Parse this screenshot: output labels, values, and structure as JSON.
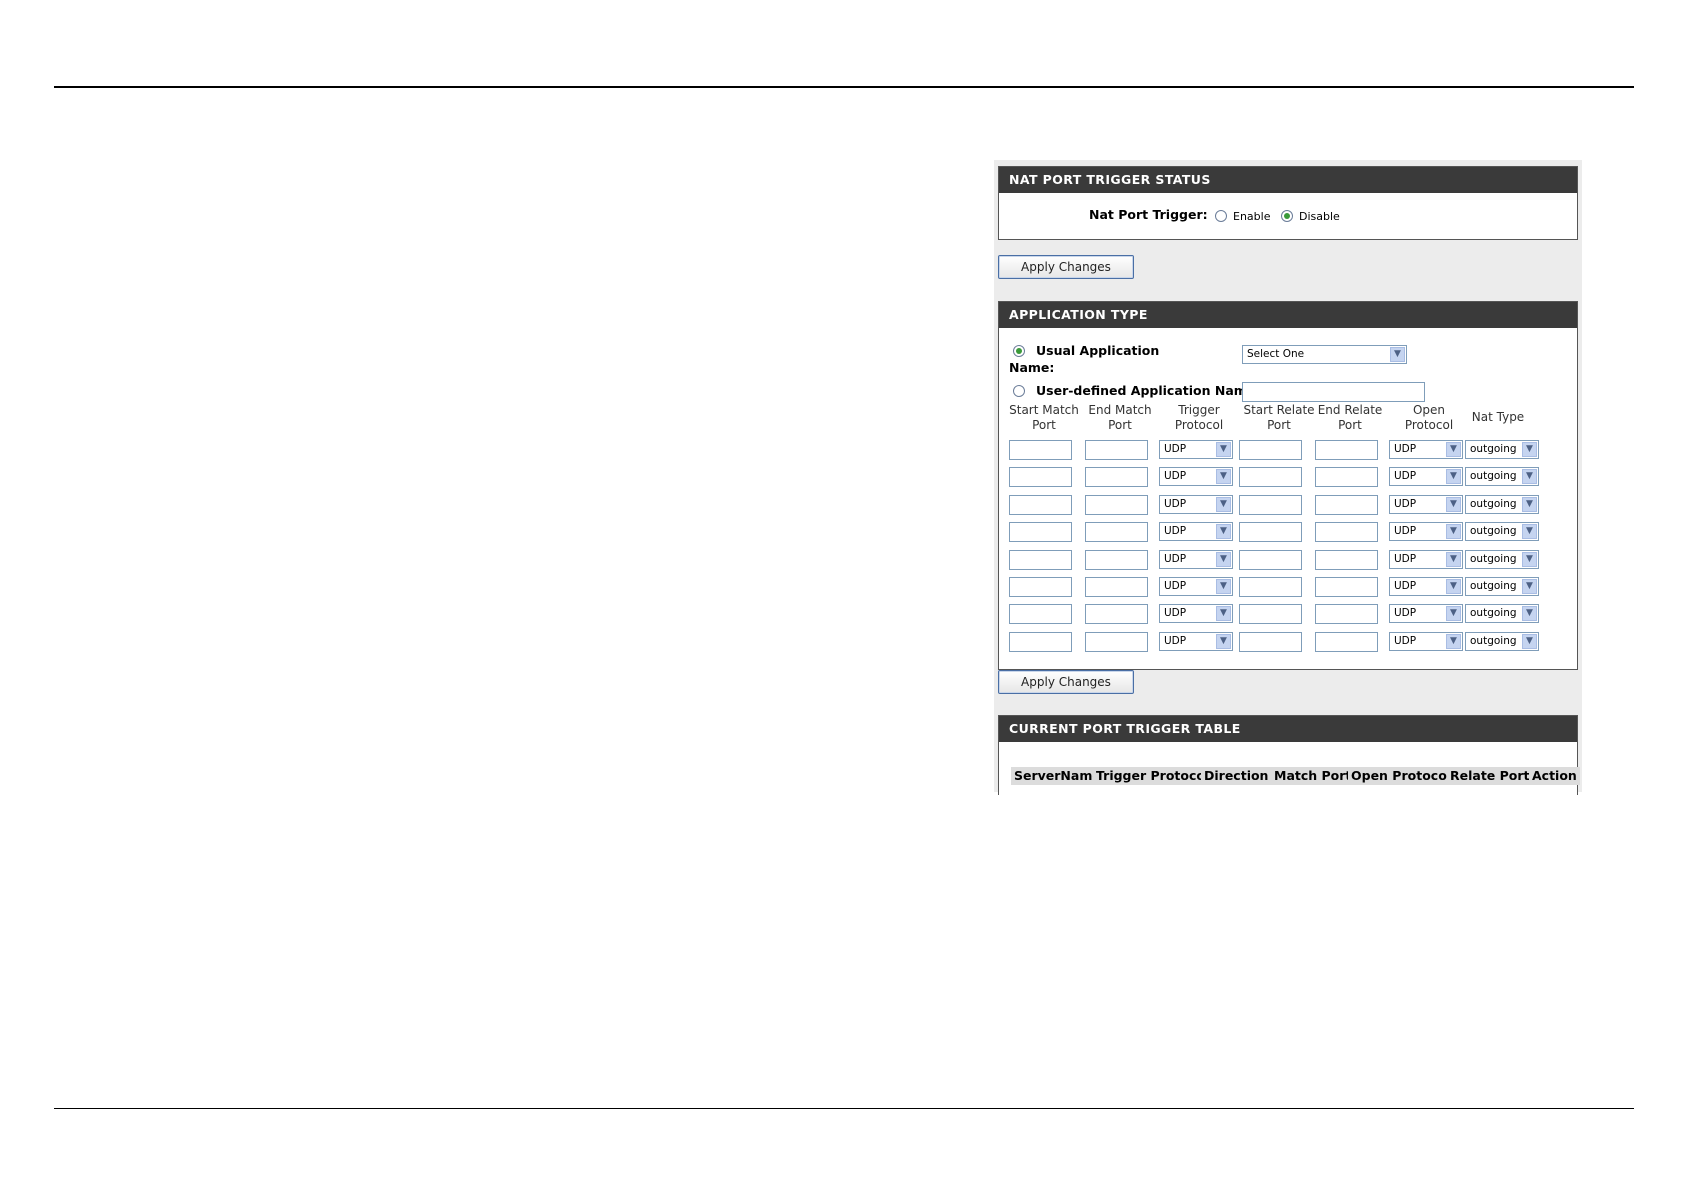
{
  "status": {
    "header": "NAT PORT TRIGGER STATUS",
    "label": "Nat Port Trigger:",
    "options": [
      "Enable",
      "Disable"
    ],
    "selected": "Disable"
  },
  "apply_label": "Apply Changes",
  "app": {
    "header": "APPLICATION TYPE",
    "usual_label_line1": "Usual Application",
    "usual_label_line2": "Name:",
    "usual_select": "Select One",
    "user_defined_label": "User-defined Application Name:",
    "selected_mode": "usual"
  },
  "columns": [
    {
      "l1": "Start Match",
      "l2": "Port"
    },
    {
      "l1": "End Match",
      "l2": "Port"
    },
    {
      "l1": "Trigger",
      "l2": "Protocol"
    },
    {
      "l1": "Start Relate",
      "l2": "Port"
    },
    {
      "l1": "End Relate",
      "l2": "Port"
    },
    {
      "l1": "Open",
      "l2": "Protocol"
    },
    {
      "l1": "Nat Type",
      "l2": ""
    }
  ],
  "rows": [
    {
      "trigger": "UDP",
      "open": "UDP",
      "nat": "outgoing"
    },
    {
      "trigger": "UDP",
      "open": "UDP",
      "nat": "outgoing"
    },
    {
      "trigger": "UDP",
      "open": "UDP",
      "nat": "outgoing"
    },
    {
      "trigger": "UDP",
      "open": "UDP",
      "nat": "outgoing"
    },
    {
      "trigger": "UDP",
      "open": "UDP",
      "nat": "outgoing"
    },
    {
      "trigger": "UDP",
      "open": "UDP",
      "nat": "outgoing"
    },
    {
      "trigger": "UDP",
      "open": "UDP",
      "nat": "outgoing"
    },
    {
      "trigger": "UDP",
      "open": "UDP",
      "nat": "outgoing"
    }
  ],
  "table": {
    "header": "CURRENT PORT TRIGGER TABLE",
    "columns": [
      "ServerName",
      "Trigger Protocol",
      "Direction",
      "Match Port",
      "Open Protocol",
      "Relate Port",
      "Action"
    ]
  }
}
